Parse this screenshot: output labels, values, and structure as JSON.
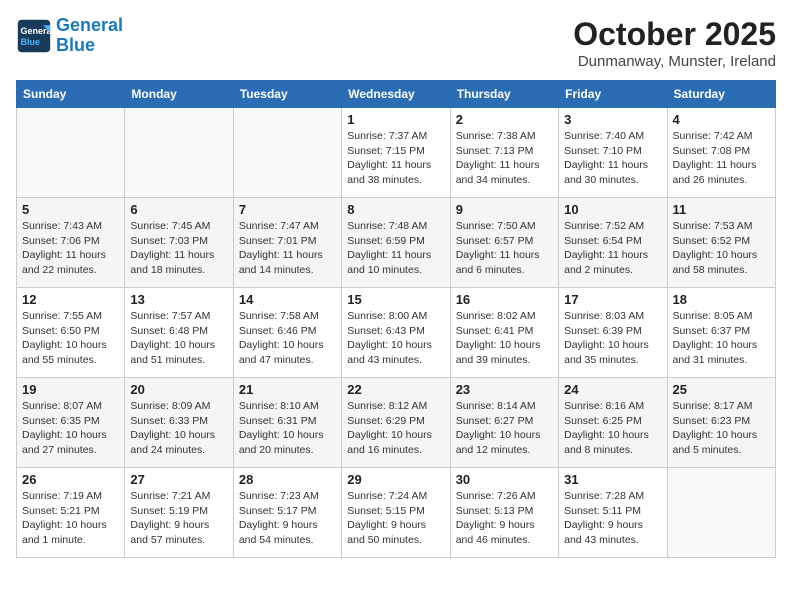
{
  "header": {
    "logo_line1": "General",
    "logo_line2": "Blue",
    "month": "October 2025",
    "location": "Dunmanway, Munster, Ireland"
  },
  "days_of_week": [
    "Sunday",
    "Monday",
    "Tuesday",
    "Wednesday",
    "Thursday",
    "Friday",
    "Saturday"
  ],
  "weeks": [
    [
      {
        "num": "",
        "info": ""
      },
      {
        "num": "",
        "info": ""
      },
      {
        "num": "",
        "info": ""
      },
      {
        "num": "1",
        "info": "Sunrise: 7:37 AM\nSunset: 7:15 PM\nDaylight: 11 hours\nand 38 minutes."
      },
      {
        "num": "2",
        "info": "Sunrise: 7:38 AM\nSunset: 7:13 PM\nDaylight: 11 hours\nand 34 minutes."
      },
      {
        "num": "3",
        "info": "Sunrise: 7:40 AM\nSunset: 7:10 PM\nDaylight: 11 hours\nand 30 minutes."
      },
      {
        "num": "4",
        "info": "Sunrise: 7:42 AM\nSunset: 7:08 PM\nDaylight: 11 hours\nand 26 minutes."
      }
    ],
    [
      {
        "num": "5",
        "info": "Sunrise: 7:43 AM\nSunset: 7:06 PM\nDaylight: 11 hours\nand 22 minutes."
      },
      {
        "num": "6",
        "info": "Sunrise: 7:45 AM\nSunset: 7:03 PM\nDaylight: 11 hours\nand 18 minutes."
      },
      {
        "num": "7",
        "info": "Sunrise: 7:47 AM\nSunset: 7:01 PM\nDaylight: 11 hours\nand 14 minutes."
      },
      {
        "num": "8",
        "info": "Sunrise: 7:48 AM\nSunset: 6:59 PM\nDaylight: 11 hours\nand 10 minutes."
      },
      {
        "num": "9",
        "info": "Sunrise: 7:50 AM\nSunset: 6:57 PM\nDaylight: 11 hours\nand 6 minutes."
      },
      {
        "num": "10",
        "info": "Sunrise: 7:52 AM\nSunset: 6:54 PM\nDaylight: 11 hours\nand 2 minutes."
      },
      {
        "num": "11",
        "info": "Sunrise: 7:53 AM\nSunset: 6:52 PM\nDaylight: 10 hours\nand 58 minutes."
      }
    ],
    [
      {
        "num": "12",
        "info": "Sunrise: 7:55 AM\nSunset: 6:50 PM\nDaylight: 10 hours\nand 55 minutes."
      },
      {
        "num": "13",
        "info": "Sunrise: 7:57 AM\nSunset: 6:48 PM\nDaylight: 10 hours\nand 51 minutes."
      },
      {
        "num": "14",
        "info": "Sunrise: 7:58 AM\nSunset: 6:46 PM\nDaylight: 10 hours\nand 47 minutes."
      },
      {
        "num": "15",
        "info": "Sunrise: 8:00 AM\nSunset: 6:43 PM\nDaylight: 10 hours\nand 43 minutes."
      },
      {
        "num": "16",
        "info": "Sunrise: 8:02 AM\nSunset: 6:41 PM\nDaylight: 10 hours\nand 39 minutes."
      },
      {
        "num": "17",
        "info": "Sunrise: 8:03 AM\nSunset: 6:39 PM\nDaylight: 10 hours\nand 35 minutes."
      },
      {
        "num": "18",
        "info": "Sunrise: 8:05 AM\nSunset: 6:37 PM\nDaylight: 10 hours\nand 31 minutes."
      }
    ],
    [
      {
        "num": "19",
        "info": "Sunrise: 8:07 AM\nSunset: 6:35 PM\nDaylight: 10 hours\nand 27 minutes."
      },
      {
        "num": "20",
        "info": "Sunrise: 8:09 AM\nSunset: 6:33 PM\nDaylight: 10 hours\nand 24 minutes."
      },
      {
        "num": "21",
        "info": "Sunrise: 8:10 AM\nSunset: 6:31 PM\nDaylight: 10 hours\nand 20 minutes."
      },
      {
        "num": "22",
        "info": "Sunrise: 8:12 AM\nSunset: 6:29 PM\nDaylight: 10 hours\nand 16 minutes."
      },
      {
        "num": "23",
        "info": "Sunrise: 8:14 AM\nSunset: 6:27 PM\nDaylight: 10 hours\nand 12 minutes."
      },
      {
        "num": "24",
        "info": "Sunrise: 8:16 AM\nSunset: 6:25 PM\nDaylight: 10 hours\nand 8 minutes."
      },
      {
        "num": "25",
        "info": "Sunrise: 8:17 AM\nSunset: 6:23 PM\nDaylight: 10 hours\nand 5 minutes."
      }
    ],
    [
      {
        "num": "26",
        "info": "Sunrise: 7:19 AM\nSunset: 5:21 PM\nDaylight: 10 hours\nand 1 minute."
      },
      {
        "num": "27",
        "info": "Sunrise: 7:21 AM\nSunset: 5:19 PM\nDaylight: 9 hours\nand 57 minutes."
      },
      {
        "num": "28",
        "info": "Sunrise: 7:23 AM\nSunset: 5:17 PM\nDaylight: 9 hours\nand 54 minutes."
      },
      {
        "num": "29",
        "info": "Sunrise: 7:24 AM\nSunset: 5:15 PM\nDaylight: 9 hours\nand 50 minutes."
      },
      {
        "num": "30",
        "info": "Sunrise: 7:26 AM\nSunset: 5:13 PM\nDaylight: 9 hours\nand 46 minutes."
      },
      {
        "num": "31",
        "info": "Sunrise: 7:28 AM\nSunset: 5:11 PM\nDaylight: 9 hours\nand 43 minutes."
      },
      {
        "num": "",
        "info": ""
      }
    ]
  ]
}
